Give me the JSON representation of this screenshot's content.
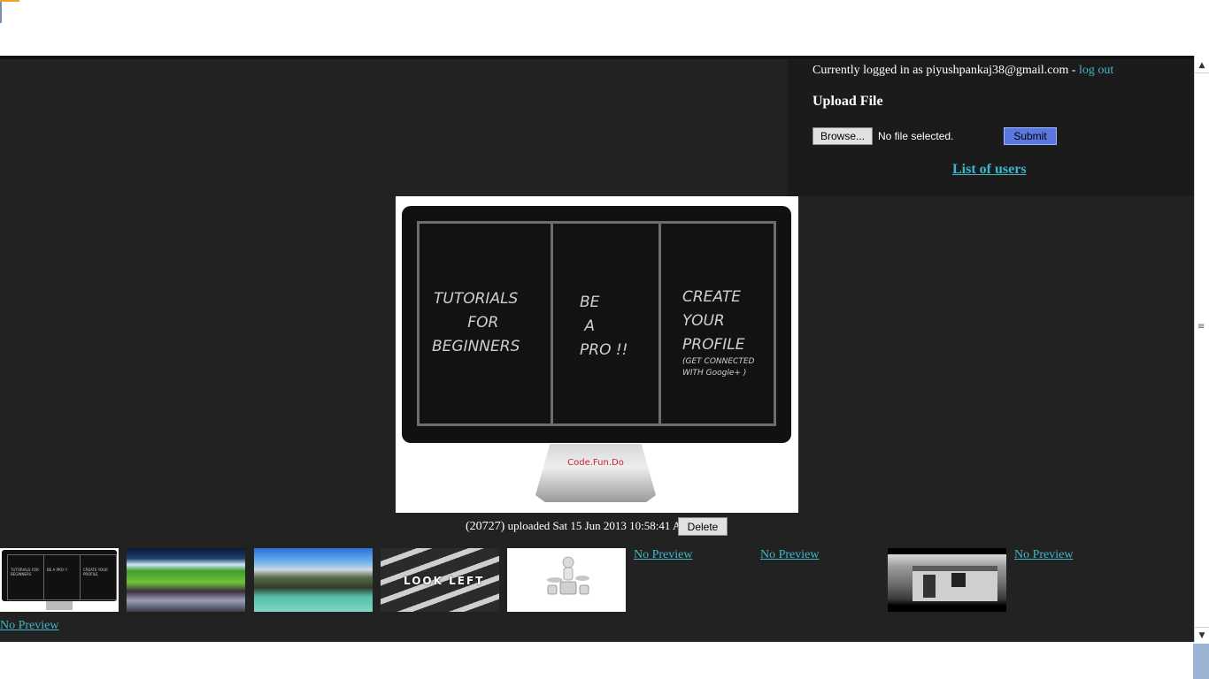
{
  "session": {
    "prefix": "Currently logged in as",
    "email": "piyushpankaj38@gmail.com",
    "separator": "-",
    "logout_label": "log out"
  },
  "upload": {
    "title": "Upload File",
    "browse_label": "Browse...",
    "no_file_text": "No file selected.",
    "submit_label": "Submit"
  },
  "list_users_label": "List of users",
  "selected_image": {
    "panes": [
      "TUTORIALS\n   FOR\nBEGINNERS",
      "BE\n A\nPRO !!",
      "CREATE\nYOUR\nPROFILE"
    ],
    "pane_small": "(GET CONNECTED\nWITH Google+ )",
    "brand": "Code.Fun.Do",
    "caption_id": "(20727)",
    "caption_text": "uploaded Sat 15 Jun 2013 10:58:41 AM",
    "delete_label": "Delete"
  },
  "thumbnails": {
    "no_preview_label": "No Preview",
    "thumb1_text": [
      "TUTORIALS FOR BEGINNERS",
      "BE A PRO !!",
      "CREATE YOUR PROFILE"
    ],
    "thumb4_text": "LOOK LEFT"
  },
  "colors": {
    "background": "#222222",
    "panel": "#1b1b1b",
    "link": "#3fb7c9",
    "submit": "#5a78e0"
  }
}
